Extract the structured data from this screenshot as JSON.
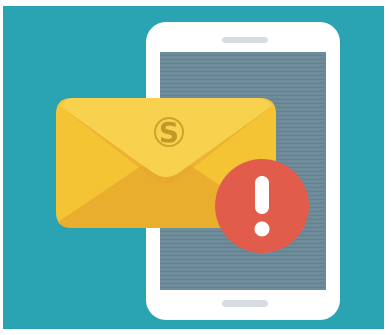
{
  "illustration": {
    "logo_text": "S",
    "alert_glyph": "!",
    "icons": [
      "smartphone-icon",
      "envelope-icon",
      "alert-badge-icon",
      "s-logo-icon"
    ]
  },
  "colors": {
    "background_teal": "#2AA3B2",
    "phone_frame": "#FFFFFF",
    "phone_screen": "#6F8C9A",
    "envelope_yellow": "#F5C435",
    "envelope_flap": "#E8A92E",
    "envelope_shadow": "#E0A030",
    "alert_red": "#E25C4C",
    "logo_gold": "#B89024"
  }
}
